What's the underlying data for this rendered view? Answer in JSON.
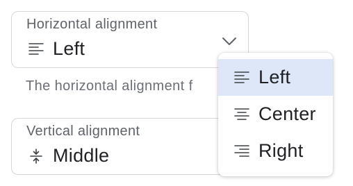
{
  "horizontal": {
    "label": "Horizontal alignment",
    "value": "Left",
    "value_icon": "align-left-icon",
    "helper": "The horizontal alignment f"
  },
  "vertical": {
    "label": "Vertical alignment",
    "value": "Middle",
    "value_icon": "align-vertical-middle-icon"
  },
  "menu": {
    "items": [
      {
        "label": "Left",
        "icon": "align-left-icon",
        "selected": true
      },
      {
        "label": "Center",
        "icon": "align-center-icon",
        "selected": false
      },
      {
        "label": "Right",
        "icon": "align-right-icon",
        "selected": false
      }
    ]
  },
  "colors": {
    "selected_bg": "#dde7f8",
    "border": "#d6d6d9",
    "label": "#5f6368",
    "helper": "#6b6f76"
  }
}
